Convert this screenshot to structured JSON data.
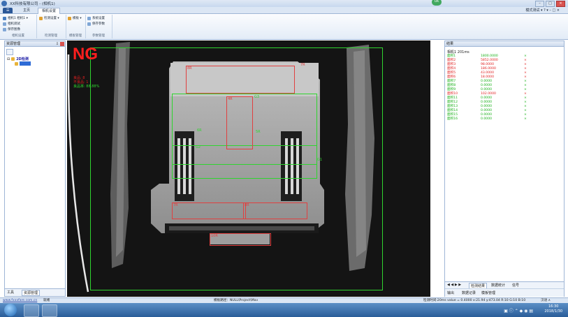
{
  "window": {
    "title": "XX科技有限公司 - (相机1)",
    "status_badge": "OK",
    "controls": [
      "–",
      "□",
      "×"
    ]
  },
  "ribbon": {
    "tabs": {
      "file": "☰",
      "home": "主页",
      "camera": "相机设置"
    },
    "topright": "模式测试 ▾  ? ▾  – □ ×",
    "groups": {
      "camera": {
        "label": "相机设置",
        "items": [
          "相机1 相机1 ▾",
          "相机调试",
          "保存图像"
        ]
      },
      "detect": {
        "label": "检测管理",
        "items": [
          "检测设置 ▾"
        ]
      },
      "template": {
        "label": "模板管理",
        "items": [
          "模板 ▾"
        ]
      },
      "param": {
        "label": "参数管理",
        "items": [
          "系统设置",
          "保存参数"
        ]
      }
    }
  },
  "left_panel": {
    "title": "资源管理",
    "pin": "⇩",
    "tree_root": "2D检测",
    "tree_child": "",
    "tabs": [
      "工具",
      "资源管理"
    ]
  },
  "viewer": {
    "result": "NG",
    "stats": {
      "good": "良品: 8",
      "bad": "不良品: 1",
      "rate": "良品率: 88.88%"
    },
    "roi_labels": {
      "top": "8R",
      "corner": "7R",
      "center": "4R",
      "bottom_left": "7R",
      "bottom_right": "8R",
      "bottom_bar": "10R",
      "mid_left": "6R",
      "mid_right": "5R",
      "green_a": "G1",
      "green_b": "G2",
      "green_c": "G3"
    }
  },
  "results": {
    "title": "结果",
    "caption": "相机1   201ms",
    "colors": {
      "ng": "#e02020",
      "ok": "#19b019"
    },
    "rows": [
      {
        "name": "面积1",
        "value": "1800.0000",
        "flag": "×",
        "status": "ok"
      },
      {
        "name": "面积2",
        "value": "5852.0000",
        "flag": "×",
        "status": "ng"
      },
      {
        "name": "面积3",
        "value": "98.0000",
        "flag": "×",
        "status": "ng"
      },
      {
        "name": "面积4",
        "value": "186.0000",
        "flag": "×",
        "status": "ng"
      },
      {
        "name": "面积5",
        "value": "43.0000",
        "flag": "×",
        "status": "ng"
      },
      {
        "name": "面积6",
        "value": "18.0000",
        "flag": "×",
        "status": "ng"
      },
      {
        "name": "面积7",
        "value": "0.0000",
        "flag": "×",
        "status": "ok"
      },
      {
        "name": "面积8",
        "value": "0.0000",
        "flag": "×",
        "status": "ok"
      },
      {
        "name": "面积9",
        "value": "0.0000",
        "flag": "×",
        "status": "ok"
      },
      {
        "name": "面积10",
        "value": "102.0000",
        "flag": "×",
        "status": "ng"
      },
      {
        "name": "面积11",
        "value": "0.0000",
        "flag": "×",
        "status": "ok"
      },
      {
        "name": "面积12",
        "value": "0.0000",
        "flag": "×",
        "status": "ok"
      },
      {
        "name": "面积13",
        "value": "0.0000",
        "flag": "×",
        "status": "ok"
      },
      {
        "name": "面积14",
        "value": "0.0000",
        "flag": "×",
        "status": "ok"
      },
      {
        "name": "面积15",
        "value": "0.0000",
        "flag": "×",
        "status": "ok"
      },
      {
        "name": "面积16",
        "value": "0.0000",
        "flag": "×",
        "status": "ok"
      }
    ],
    "tabs": [
      "◀ ◀ ▶ ▶",
      "检测结果",
      "数据统计",
      "信号"
    ],
    "bottom_tabs": [
      "输出",
      "数据记录",
      "模板管理"
    ]
  },
  "statusbar": {
    "link": "www.fxxxfare.com.cn",
    "state": "就绪",
    "path": "模板路径：NULL\\Project\\Mav",
    "right": "检测时间:20ms  value = 0.4000  x:21.94 y:473.04  R:10 G:10 B:10",
    "mode": "汉语 ∧"
  },
  "taskbar": {
    "tray": "▣ ⓘ ⌃ ◆ ◉ ▤",
    "time": "16:30",
    "date": "2018/1/30"
  }
}
